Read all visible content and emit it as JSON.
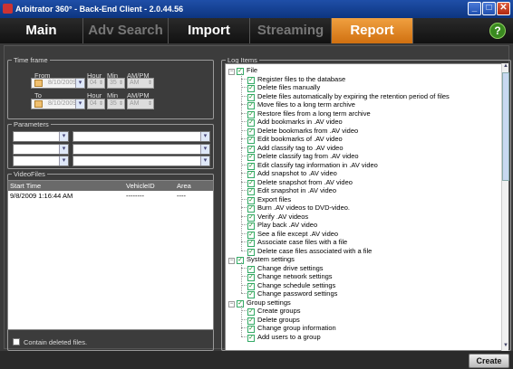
{
  "window": {
    "title": "Arbitrator 360° - Back-End Client - 2.0.44.56",
    "min": "_",
    "max": "□",
    "close": "✕"
  },
  "tabs": [
    {
      "label": "Main",
      "state": "normal"
    },
    {
      "label": "Adv Search",
      "state": "dim"
    },
    {
      "label": "Import",
      "state": "normal"
    },
    {
      "label": "Streaming",
      "state": "dim"
    },
    {
      "label": "Report",
      "state": "active"
    }
  ],
  "help_label": "?",
  "time_frame": {
    "legend": "Time frame",
    "from_label": "From",
    "to_label": "To",
    "hour_label": "Hour",
    "min_label": "Min",
    "ampm_label": "AM/PM",
    "from": {
      "date": "8/10/2009",
      "hour": "04",
      "min": "35",
      "ampm": "AM"
    },
    "to": {
      "date": "8/10/2009",
      "hour": "04",
      "min": "35",
      "ampm": "AM"
    }
  },
  "parameters": {
    "legend": "Parameters"
  },
  "video_files": {
    "legend": "VideoFiles",
    "columns": [
      "Start Time",
      "VehicleID",
      "Area"
    ],
    "rows": [
      [
        "9/8/2009 1:16:44 AM",
        "--------",
        "----"
      ]
    ]
  },
  "contain_deleted": "Contain deleted files.",
  "log_items": {
    "legend": "Log Items",
    "groups": [
      {
        "label": "File",
        "items": [
          "Register files to the database",
          "Delete files manually",
          "Delete files automatically by expiring the retention period of files",
          "Move files to a long term archive",
          "Restore files from a long term archive",
          "Add bookmarks in .AV video",
          "Delete bookmarks from .AV video",
          "Edit bookmarks of .AV video",
          "Add classify tag to .AV video",
          "Delete classify tag from .AV video",
          "Edit classify tag information in .AV video",
          "Add snapshot to .AV video",
          "Delete snapshot from .AV video",
          "Edit snapshot in .AV video",
          "Export files",
          "Burn .AV videos to DVD-video.",
          "Verify .AV videos",
          "Play back .AV video",
          "See a file except .AV video",
          "Associate case files with a file",
          "Delete case files associated with a file"
        ]
      },
      {
        "label": "System settings",
        "items": [
          "Change drive settings",
          "Change network settings",
          "Change schedule settings",
          "Change password settings"
        ]
      },
      {
        "label": "Group settings",
        "items": [
          "Create groups",
          "Delete groups",
          "Change group information",
          "Add users to a group"
        ]
      }
    ]
  },
  "create_label": "Create"
}
